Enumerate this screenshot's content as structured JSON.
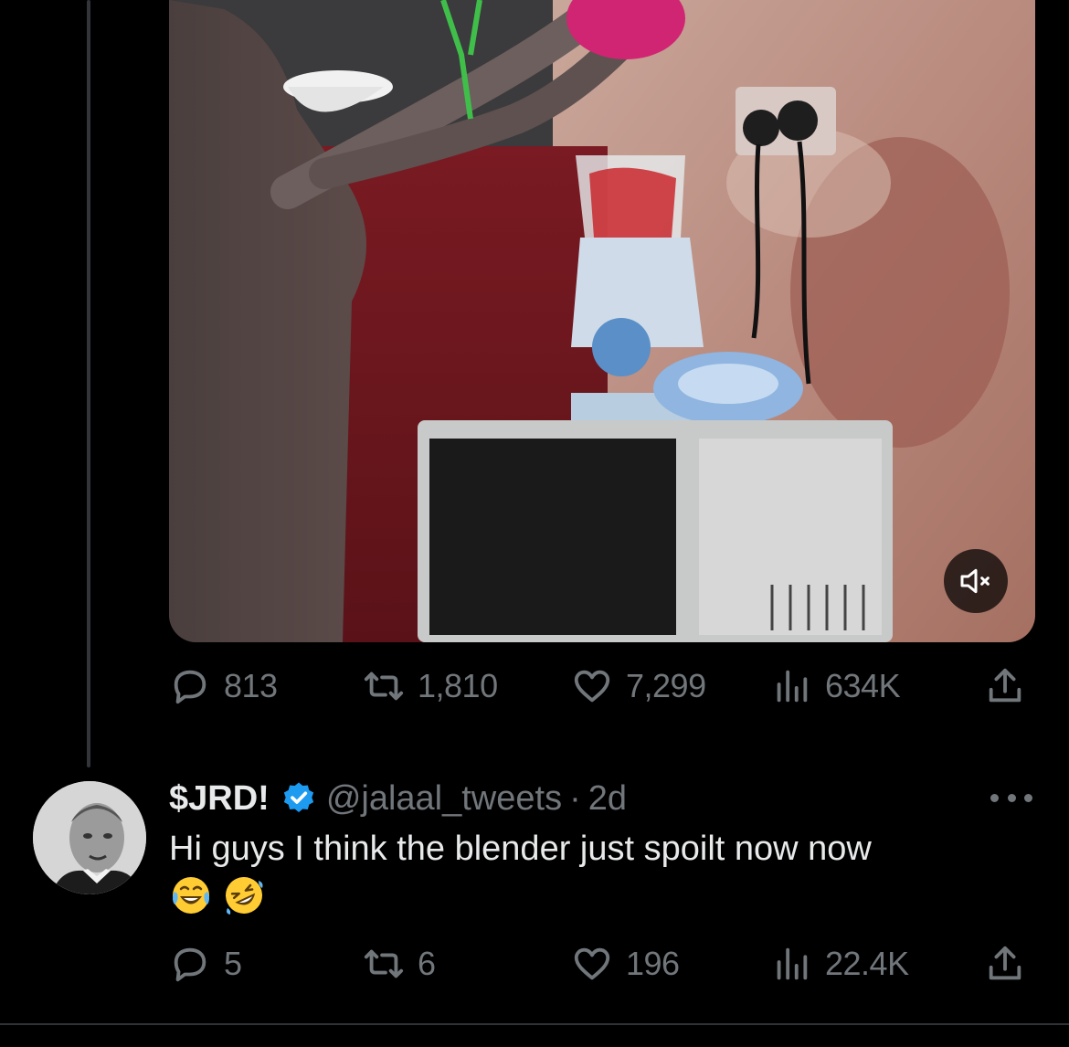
{
  "parent_tweet": {
    "stats": {
      "replies": "813",
      "reposts": "1,810",
      "likes": "7,299",
      "views": "634K"
    },
    "media": {
      "type": "video",
      "muted": true,
      "mute_icon": "speaker-muted-icon"
    }
  },
  "reply": {
    "display_name": "$JRD!",
    "handle": "@jalaal_tweets",
    "separator": "·",
    "time": "2d",
    "verified": true,
    "text": "Hi guys I think the blender just spoilt now now",
    "emojis": [
      "face-with-tears-of-joy",
      "rolling-on-the-floor-laughing"
    ],
    "stats": {
      "replies": "5",
      "reposts": "6",
      "likes": "196",
      "views": "22.4K"
    }
  },
  "colors": {
    "background": "#000000",
    "text_primary": "#e7e9ea",
    "text_secondary": "#71767b",
    "verified_blue": "#1d9bf0",
    "divider": "#2f3336"
  }
}
